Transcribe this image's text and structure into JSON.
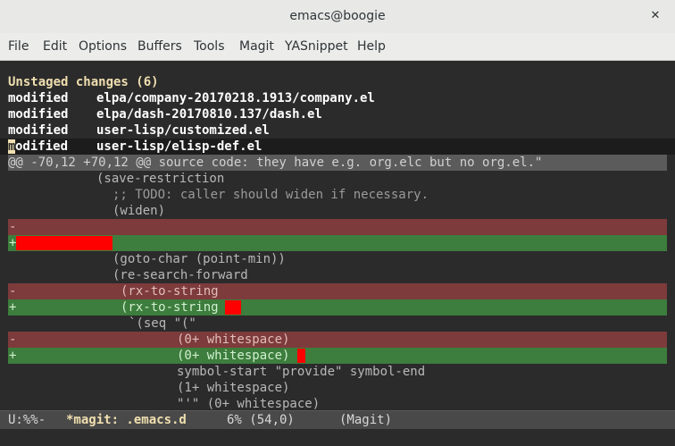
{
  "window": {
    "title": "emacs@boogie",
    "close_glyph": "✕"
  },
  "menu": [
    "File",
    "Edit",
    "Options",
    "Buffers",
    "Tools",
    "Magit",
    "YASnippet",
    "Help"
  ],
  "status": {
    "header": "Unstaged changes (6)",
    "files": [
      {
        "kind": "modified",
        "path": "elpa/company-20170218.1913/company.el"
      },
      {
        "kind": "modified",
        "path": "elpa/dash-20170810.137/dash.el"
      },
      {
        "kind": "modified",
        "path": "user-lisp/customized.el"
      },
      {
        "kind": "modified",
        "path": "user-lisp/elisp-def.el"
      }
    ],
    "cursor_char": "m",
    "cursor_rest": "odified",
    "hunk_header": "@@ -70,12 +70,12 @@ source code: they have e.g. org.elc but no org.el.\""
  },
  "diff": {
    "l1": "(save-restriction",
    "l2": ";; TODO: caller should widen if necessary.",
    "l3": "(widen)",
    "rem_sign": "-",
    "add_sign": "+",
    "l6": "(goto-char (point-min))",
    "l7": "(re-search-forward",
    "l8": "(rx-to-string",
    "l9": "(rx-to-string",
    "l10": "`(seq \"(\"",
    "l11": "(0+ whitespace)",
    "l12": "(0+ whitespace)",
    "l13": "symbol-start \"provide\" symbol-end",
    "l14": "(1+ whitespace)",
    "l15": "\"'\" (0+ whitespace)"
  },
  "modeline": {
    "state": "U:%%-",
    "buffer": "*magit: .emacs.d",
    "position": "6% (54,0)",
    "mode": "(Magit)"
  },
  "colors": {
    "background": "#2b2b2b",
    "removed": "#7d3b3b",
    "added": "#3d7d3d",
    "whitespace_error": "#ff0000",
    "heading": "#f0dfaf"
  }
}
